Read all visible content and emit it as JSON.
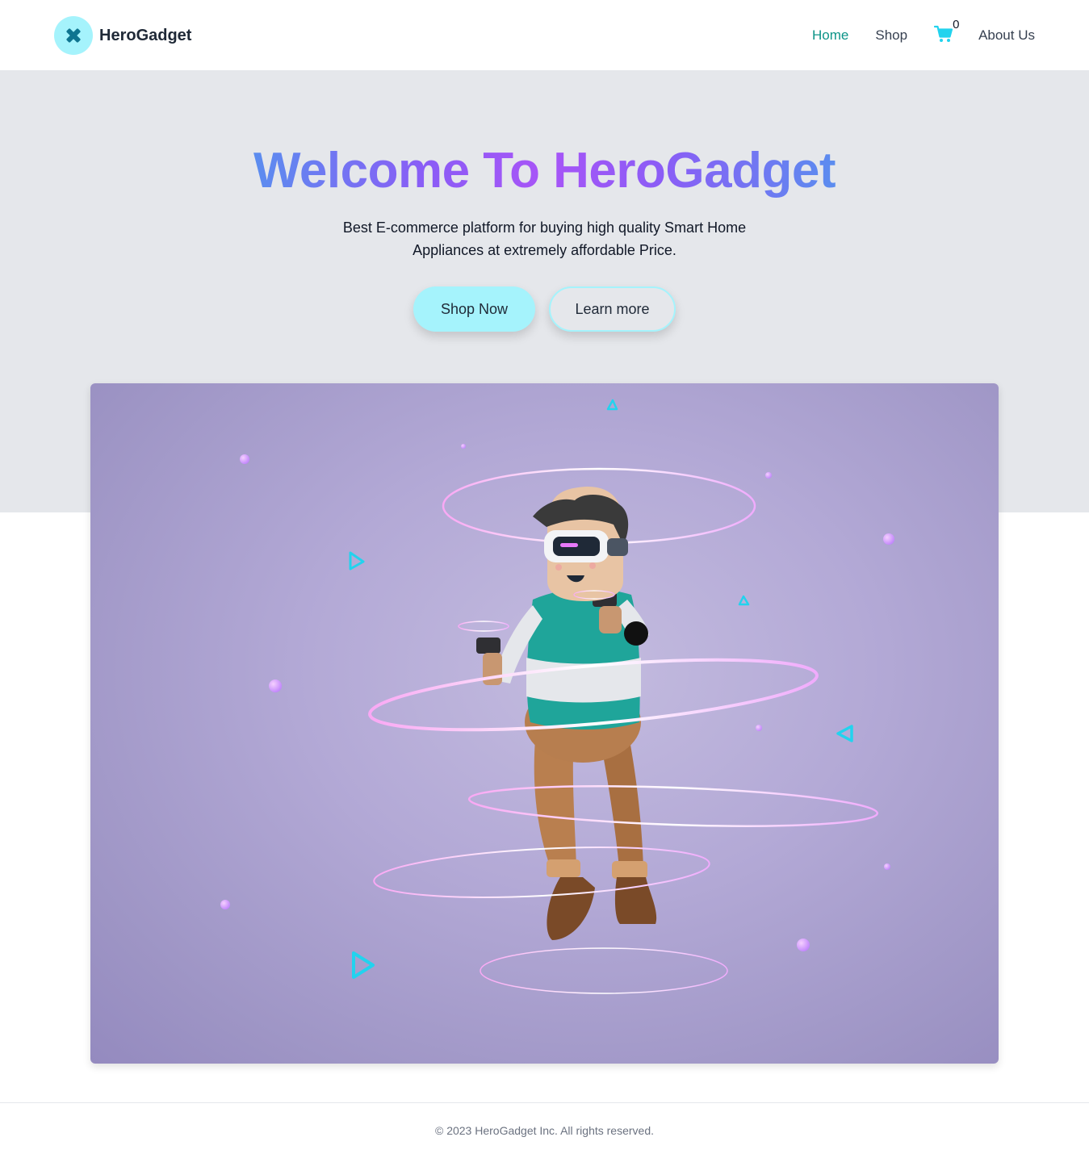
{
  "brand": {
    "name": "HeroGadget",
    "logo_icon": "cross-icon",
    "accent_color": "#a5f3fc"
  },
  "nav": {
    "items": [
      {
        "label": "Home",
        "active": true
      },
      {
        "label": "Shop",
        "active": false
      },
      {
        "label": "About Us",
        "active": false
      }
    ],
    "cart": {
      "icon": "cart-icon",
      "count": "0"
    }
  },
  "hero": {
    "title": "Welcome To HeroGadget",
    "subtitle": "Best E-commerce platform for buying high quality Smart Home Appliances at extremely affordable Price.",
    "primary_button": "Shop Now",
    "secondary_button": "Learn more",
    "image": "vr-character-illustration"
  },
  "footer": {
    "copyright": "© 2023 HeroGadget Inc. All rights reserved."
  }
}
